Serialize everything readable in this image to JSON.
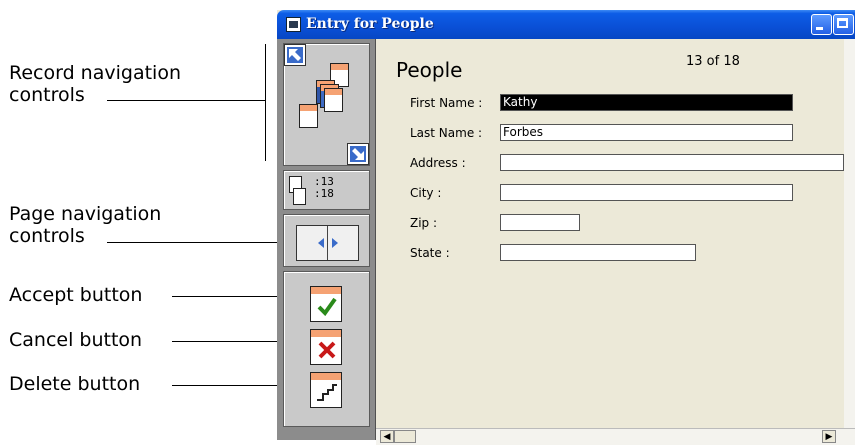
{
  "callouts": {
    "record_nav": [
      "Record navigation",
      "controls"
    ],
    "page_nav": [
      "Page navigation",
      "controls"
    ],
    "accept": "Accept button",
    "cancel": "Cancel button",
    "delete": "Delete button"
  },
  "window": {
    "title": "Entry for People"
  },
  "toolbar": {
    "record_current": ":13",
    "record_total": ":18"
  },
  "form": {
    "title": "People",
    "record_count": "13 of 18",
    "fields": {
      "first_name": {
        "label": "First Name :",
        "value": "Kathy"
      },
      "last_name": {
        "label": "Last Name :",
        "value": "Forbes"
      },
      "address": {
        "label": "Address :",
        "value": ""
      },
      "city": {
        "label": "City :",
        "value": ""
      },
      "zip": {
        "label": "Zip :",
        "value": ""
      },
      "state": {
        "label": "State :",
        "value": ""
      }
    }
  },
  "icons": {
    "record_prev": "arrow-up-left-icon",
    "record_next": "arrow-down-right-icon",
    "accept": "checkmark-icon",
    "cancel": "x-icon",
    "delete": "torn-page-icon"
  },
  "colors": {
    "titlebar": "#0a4fd6",
    "accent_orange": "#f5a273",
    "check_green": "#2a8a1a",
    "cancel_red": "#c81818"
  }
}
